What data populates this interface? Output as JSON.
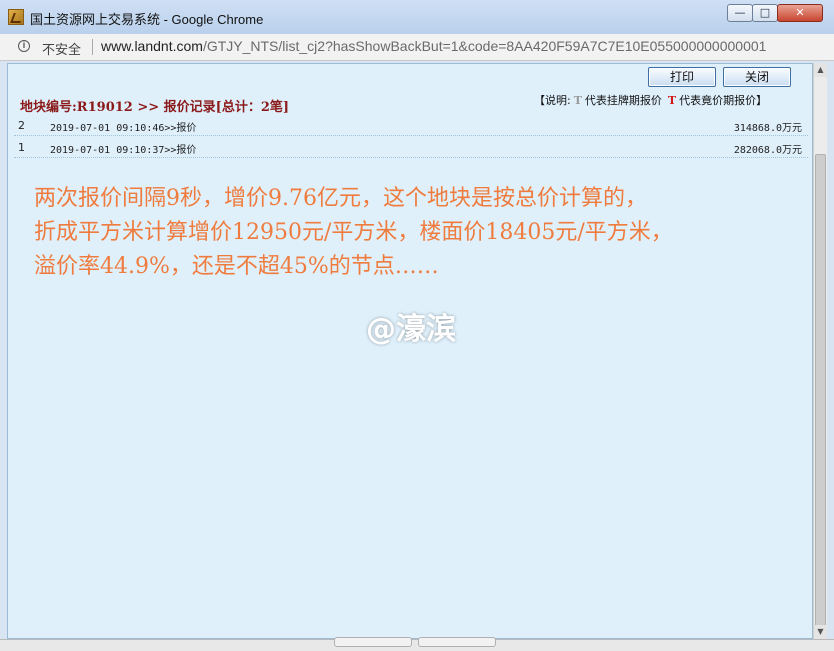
{
  "window": {
    "title": "国土资源网上交易系统 - Google Chrome",
    "min_glyph": "—",
    "max_glyph": "□",
    "close_glyph": "✕"
  },
  "address": {
    "security_label": "不安全",
    "host": "www.landnt.com",
    "path": "/GTJY_NTS/list_cj2?hasShowBackBut=1&code=8AA420F59A7C7E10E055000000000001"
  },
  "toolbar": {
    "print_label": "打印",
    "close_label": "关闭"
  },
  "heading": "地块编号:R19012 >> 报价记录[总计：2笔]",
  "legend": {
    "open": "【说明:",
    "t_listing": "T",
    "listing_label": "代表挂牌期报价",
    "t_bidding": "T",
    "bidding_label": "代表竟价期报价】"
  },
  "bids": [
    {
      "idx": "2",
      "time": "2019-07-01 09:10:46>>报价",
      "price": "314868.0万元"
    },
    {
      "idx": "1",
      "time": "2019-07-01 09:10:37>>报价",
      "price": "282068.0万元"
    }
  ],
  "note": {
    "line1": "两次报价间隔9秒，增价9.76亿元，这个地块是按总价计算的，",
    "line2": "折成平方米计算增价12950元/平方米，楼面价18405元/平方米，",
    "line3": "溢价率44.9%，还是不超45%的节点……"
  },
  "watermark": "@濠滨",
  "colors": {
    "heading": "#8b1a1a",
    "note": "#ef7c3e",
    "bidding_t": "#d01818",
    "content_bg": "#dff0fb"
  }
}
